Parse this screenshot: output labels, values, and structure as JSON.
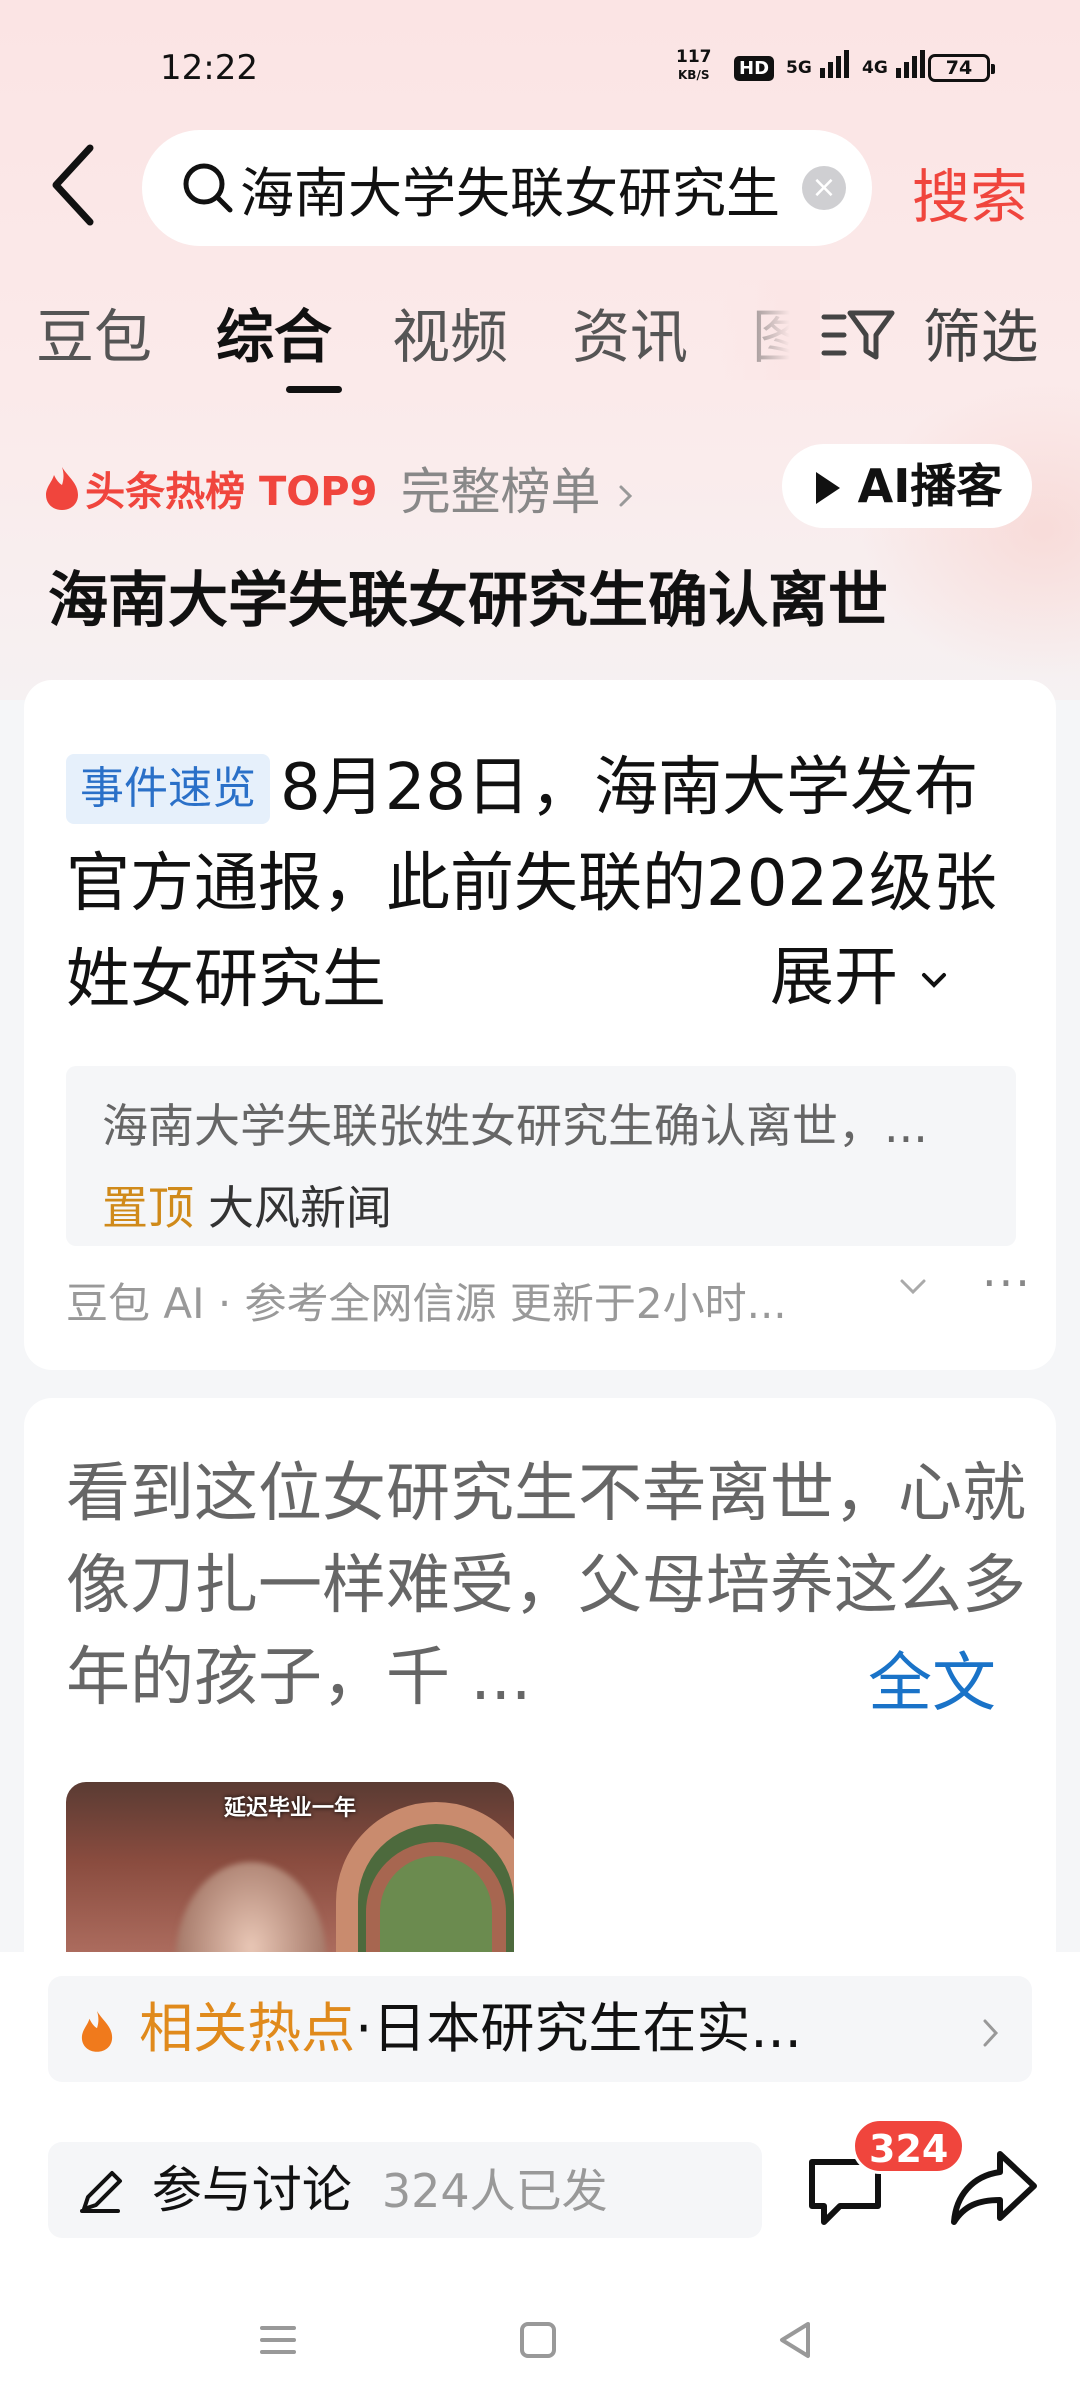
{
  "status_bar": {
    "time": "12:22",
    "net_speed_value": "117",
    "net_speed_unit": "KB/S",
    "hd": "HD",
    "signal1": "5G",
    "signal2": "4G",
    "battery": "74"
  },
  "search": {
    "query": "海南大学失联女研究生",
    "button": "搜索"
  },
  "tabs": [
    "豆包",
    "综合",
    "视频",
    "资讯",
    "图"
  ],
  "active_tab": "综合",
  "filter_label": "筛选",
  "hot_rank": {
    "label": "头条热榜 TOP9",
    "full_list": "完整榜单",
    "podcast": "AI播客",
    "title": "海南大学失联女研究生确认离世"
  },
  "event_card": {
    "tag": "事件速览",
    "text": "8月28日，海南大学发布官方通报，此前失联的2022级张姓女研究生",
    "expand": "展开",
    "source_title": "海南大学失联张姓女研究生确认离世，...",
    "pin": "置顶",
    "source_name": "大风新闻",
    "meta": "豆包 AI · 参考全网信源 更新于2小时..."
  },
  "post_card": {
    "text": "看到这位女研究生不幸离世，心就像刀扎一样难受，父母培养这么多年的孩子，千 ...",
    "full": "全文",
    "thumb_caption": "延迟毕业一年"
  },
  "related": {
    "label": "相关热点",
    "text": "·日本研究生在实..."
  },
  "action_bar": {
    "discuss_label": "参与讨论",
    "discuss_count": "324人已发",
    "comment_count": "324"
  },
  "colors": {
    "accent_red": "#f0453d",
    "link_blue": "#1a73c8",
    "hot_orange": "#e08a1c"
  }
}
